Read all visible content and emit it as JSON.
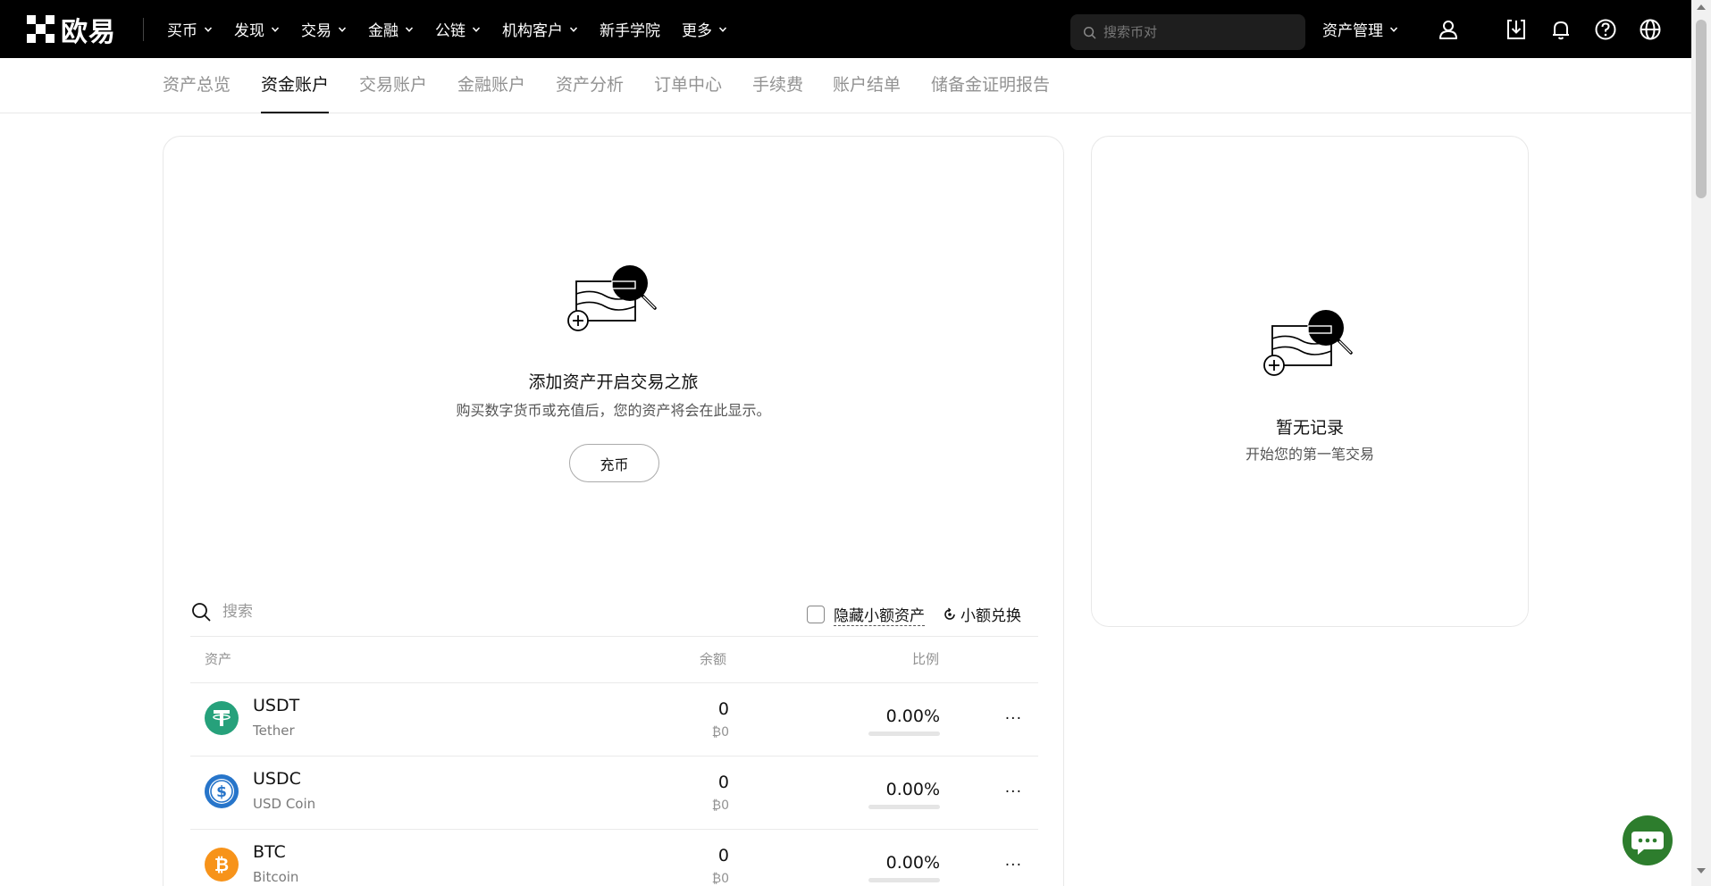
{
  "brand": {
    "name": "欧易"
  },
  "nav": {
    "items": [
      {
        "label": "买币",
        "dropdown": true
      },
      {
        "label": "发现",
        "dropdown": true
      },
      {
        "label": "交易",
        "dropdown": true
      },
      {
        "label": "金融",
        "dropdown": true
      },
      {
        "label": "公链",
        "dropdown": true
      },
      {
        "label": "机构客户",
        "dropdown": true
      },
      {
        "label": "新手学院",
        "dropdown": false
      },
      {
        "label": "更多",
        "dropdown": true
      }
    ],
    "search_placeholder": "搜索币对",
    "asset_management": "资产管理",
    "icons": [
      "user-icon",
      "download-icon",
      "bell-icon",
      "help-icon",
      "globe-icon"
    ]
  },
  "subtabs": {
    "items": [
      "资产总览",
      "资金账户",
      "交易账户",
      "金融账户",
      "资产分析",
      "订单中心",
      "手续费",
      "账户结单",
      "储备金证明报告"
    ],
    "active": "资金账户"
  },
  "main": {
    "empty_title": "添加资产开启交易之旅",
    "empty_subtitle": "购买数字货币或充值后，您的资产将会在此显示。",
    "deposit_button": "充币",
    "search_placeholder": "搜索",
    "hide_small_label": "隐藏小额资产",
    "small_convert_label": "小额兑换",
    "columns": {
      "asset": "资产",
      "balance": "余额",
      "ratio": "比例"
    },
    "assets": [
      {
        "symbol": "USDT",
        "name": "Tether",
        "balance": "0",
        "balance_sub": "₿0",
        "ratio": "0.00%",
        "icon": "tether-icon",
        "color": "#26a17b"
      },
      {
        "symbol": "USDC",
        "name": "USD Coin",
        "balance": "0",
        "balance_sub": "₿0",
        "ratio": "0.00%",
        "icon": "usdc-icon",
        "color": "#2775ca"
      },
      {
        "symbol": "BTC",
        "name": "Bitcoin",
        "balance": "0",
        "balance_sub": "₿0",
        "ratio": "0.00%",
        "icon": "bitcoin-icon",
        "color": "#f7931a"
      }
    ]
  },
  "side": {
    "empty_title": "暂无记录",
    "empty_subtitle": "开始您的第一笔交易"
  },
  "colors": {
    "nav_bg": "#000000",
    "accent": "#121212"
  }
}
